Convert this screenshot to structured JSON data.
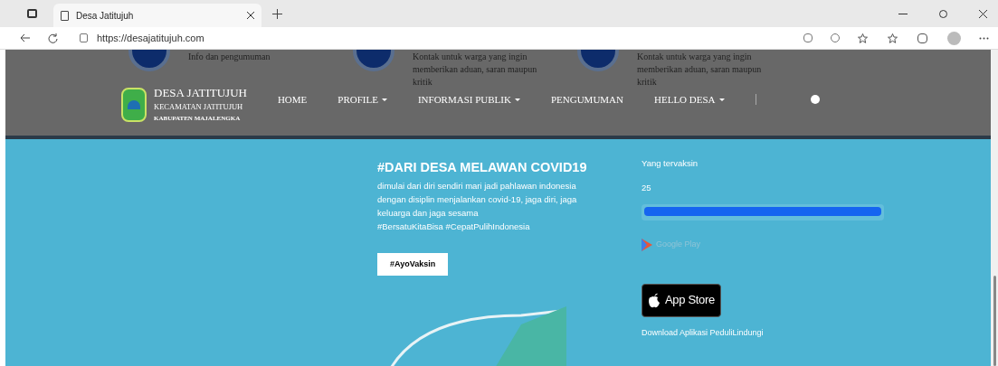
{
  "browser": {
    "tab_title": "Desa Jatitujuh",
    "url": "https://desajatitujuh.com"
  },
  "behind_cards": [
    {
      "text": "Info dan pengumuman"
    },
    {
      "text": "Kontak untuk warga yang ingin memberikan aduan, saran maupun kritik"
    },
    {
      "text": "Kontak untuk warga yang ingin memberikan aduan, saran maupun kritik"
    }
  ],
  "brand": {
    "name": "DESA JATITUJUH",
    "district": "KECAMATAN JATITUJUH",
    "regency": "KABUPATEN MAJALENGKA"
  },
  "nav": [
    {
      "label": "HOME",
      "dropdown": false
    },
    {
      "label": "PROFILE",
      "dropdown": true
    },
    {
      "label": "INFORMASI PUBLIK",
      "dropdown": true
    },
    {
      "label": "PENGUMUMAN",
      "dropdown": false
    },
    {
      "label": "HELLO DESA",
      "dropdown": true
    }
  ],
  "hero": {
    "title": "#DARI DESA MELAWAN COVID19",
    "body": "dimulai dari diri sendiri mari jadi pahlawan indonesia dengan disiplin menjalankan covid-19, jaga diri, jaga keluarga dan jaga sesama",
    "tags": "#BersatuKitaBisa #CepatPulihIndonesia",
    "button": "#AyoVaksin"
  },
  "vaccine": {
    "label": "Yang tervaksin",
    "count": "25",
    "level": 1
  },
  "stores": {
    "google_play": "Google Play",
    "app_store": "App Store",
    "download": "Download Aplikasi PeduliLindungi"
  }
}
